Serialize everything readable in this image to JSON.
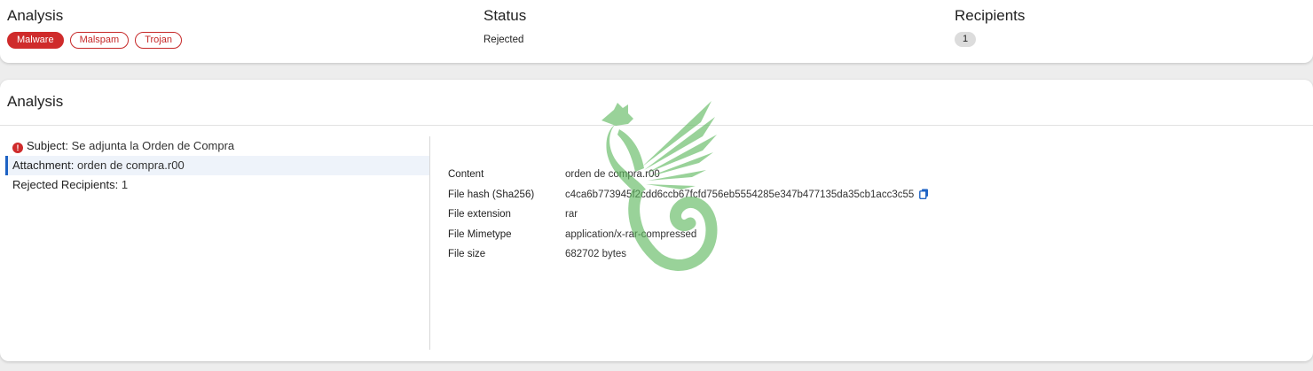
{
  "summary": {
    "analysis": {
      "heading": "Analysis",
      "tags": [
        "Malware",
        "Malspam",
        "Trojan"
      ]
    },
    "status": {
      "heading": "Status",
      "value": "Rejected"
    },
    "recipients": {
      "heading": "Recipients",
      "count": "1"
    }
  },
  "analysis_panel": {
    "title": "Analysis",
    "tree": [
      {
        "key": "Subject:",
        "value": "Se adjunta la Orden de Compra"
      },
      {
        "key": "Attachment:",
        "value": "orden de compra.r00"
      },
      {
        "key": "Rejected Recipients:",
        "value": "1"
      }
    ],
    "details": [
      {
        "key": "Content",
        "value": "orden de compra.r00"
      },
      {
        "key": "File hash (Sha256)",
        "value": "c4ca6b773945f2cdd6ccb67fcfd756eb5554285e347b477135da35cb1acc3c55"
      },
      {
        "key": "File extension",
        "value": "rar"
      },
      {
        "key": "File Mimetype",
        "value": "application/x-rar-compressed"
      },
      {
        "key": "File size",
        "value": "682702 bytes"
      }
    ]
  },
  "icons": {
    "error": "error-circle-icon",
    "copy": "copy-icon",
    "watermark": "phoenix-logo-watermark"
  },
  "colors": {
    "malware": "#cf2b2b",
    "accent": "#1d62c4",
    "logo": "#5cb85c"
  }
}
